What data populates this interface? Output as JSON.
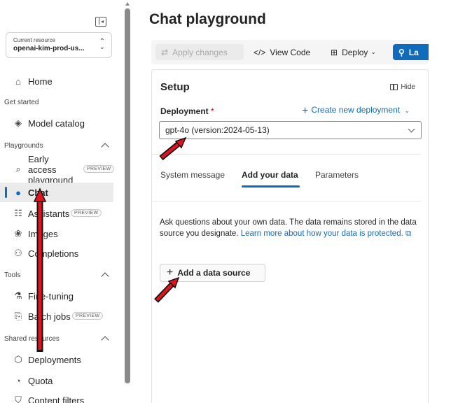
{
  "sidebar": {
    "resource_label": "Current resource",
    "resource_value": "openai-kim-prod-us...",
    "nav": {
      "home": "Home",
      "model_catalog": "Model catalog",
      "early_access": "Early access playground",
      "chat": "Chat",
      "assistants": "Assistants",
      "images": "Images",
      "completions": "Completions",
      "fine_tuning": "Fine-tuning",
      "batch_jobs": "Batch jobs",
      "deployments": "Deployments",
      "quota": "Quota",
      "content_filters": "Content filters"
    },
    "sections": {
      "get_started": "Get started",
      "playgrounds": "Playgrounds",
      "tools": "Tools",
      "shared_resources": "Shared resources"
    },
    "preview_badge": "PREVIEW"
  },
  "main": {
    "title": "Chat playground",
    "toolbar": {
      "apply_changes": "Apply changes",
      "view_code": "View Code",
      "deploy": "Deploy",
      "launch": "La"
    },
    "setup": {
      "title": "Setup",
      "hide": "Hide",
      "deployment_label": "Deployment",
      "required_mark": "*",
      "create_new": "Create new deployment",
      "deployment_value": "gpt-4o (version:2024-05-13)",
      "tabs": [
        "System message",
        "Add your data",
        "Parameters"
      ],
      "description": "Ask questions about your own data. The data remains stored in the data source you designate.",
      "learn_more": "Learn more about how your data is protected.",
      "add_data_source": "Add a data source"
    }
  },
  "colors": {
    "accent": "#0f6cbd",
    "annotation": "#e0141e"
  }
}
